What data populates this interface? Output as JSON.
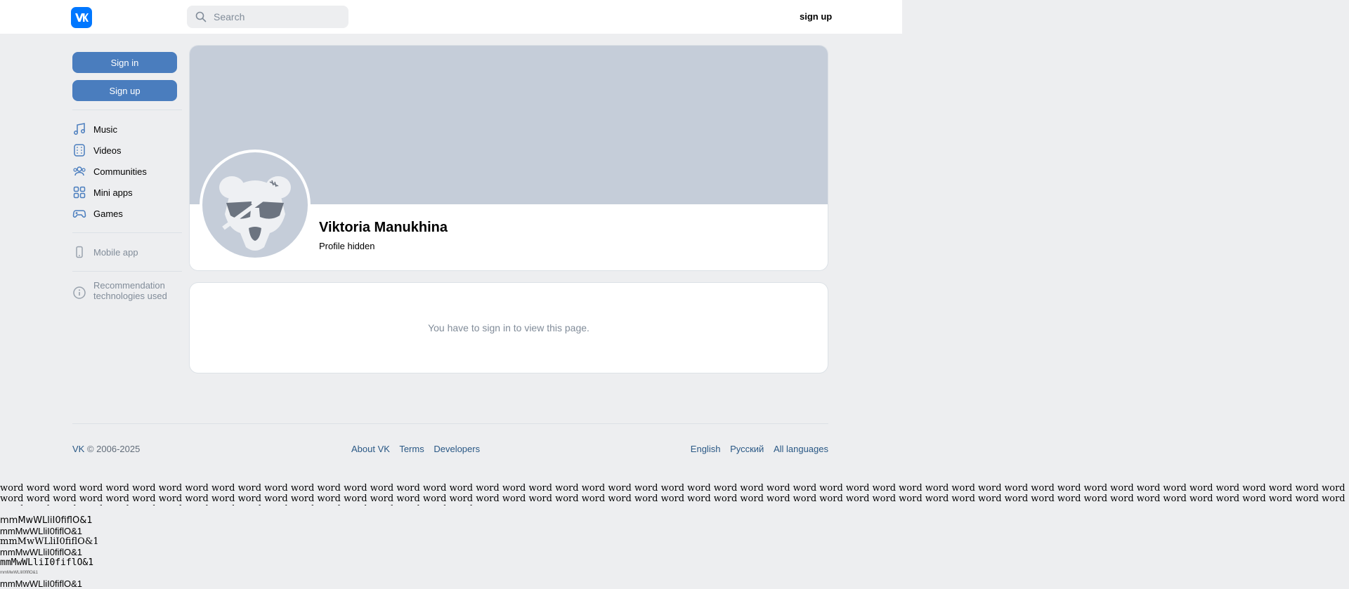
{
  "header": {
    "logo_icon": "vk-logo-icon",
    "search_placeholder": "Search",
    "signup_label": "sign up"
  },
  "sidebar": {
    "signin_label": "Sign in",
    "signup_label": "Sign up",
    "nav": [
      {
        "label": "Music",
        "icon": "music-icon"
      },
      {
        "label": "Videos",
        "icon": "video-icon"
      },
      {
        "label": "Communities",
        "icon": "communities-icon"
      },
      {
        "label": "Mini apps",
        "icon": "mini-apps-icon"
      },
      {
        "label": "Games",
        "icon": "gamepad-icon"
      }
    ],
    "mobile_app_label": "Mobile app",
    "recommendation_line1": "Recommendation",
    "recommendation_line2": "technologies used"
  },
  "profile": {
    "name": "Viktoria Manukhina",
    "status": "Profile hidden"
  },
  "notice": {
    "text": "You have to sign in to view this page."
  },
  "footer": {
    "brand": "VK",
    "copyright": " © 2006-2025",
    "links": [
      "About VK",
      "Terms",
      "Developers"
    ],
    "languages": [
      "English",
      "Русский",
      "All languages"
    ]
  },
  "raw_text": {
    "word": "word",
    "word_count": 120,
    "samples": [
      "mmMwWLliI0fiflO&1",
      "mmMwWLliI0fiflO&1",
      "mmMwWLliI0fiflO&1",
      "mmMwWLliI0fiflO&1",
      "mmMwWLliI0fiflO&1",
      "mmMwWLliI0fiflO&1",
      "mmMwWLliI0fiflO&1"
    ]
  },
  "colors": {
    "accent": "#0077ff",
    "button": "#4a7dbe",
    "link": "#2a5885",
    "cover": "#c5cdd9",
    "background": "#edeef0"
  }
}
